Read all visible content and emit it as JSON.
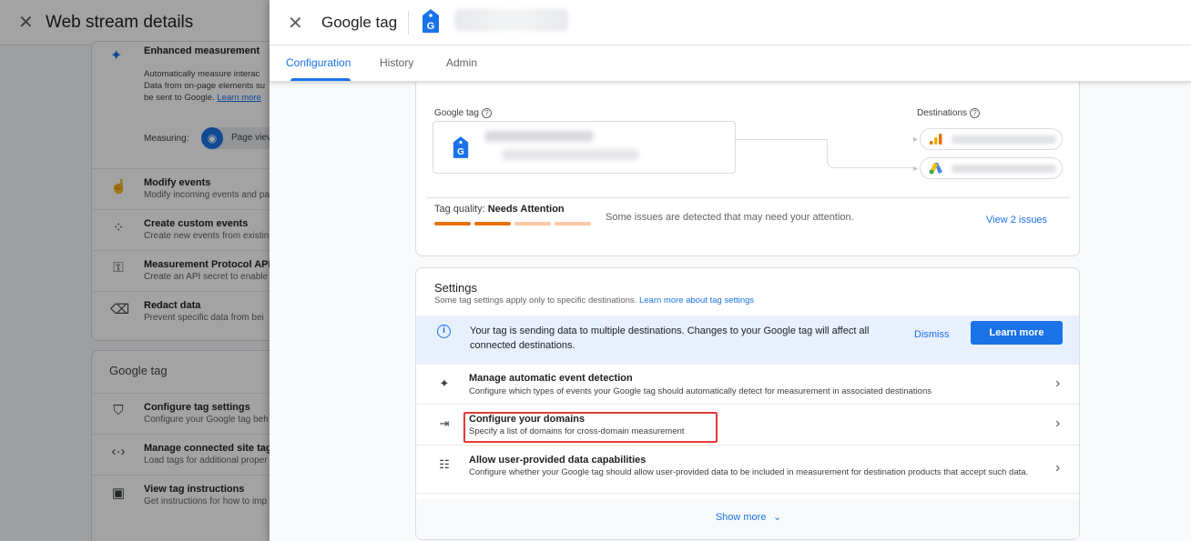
{
  "background": {
    "title": "Web stream details",
    "enhanced": {
      "title": "Enhanced measurement",
      "desc_line1": "Automatically measure interac",
      "desc_line2": "Data from on-page elements su",
      "desc_line3": "be sent to Google.",
      "learn_more": "Learn more",
      "measuring_label": "Measuring:",
      "pill_label": "Page viev"
    },
    "items": [
      {
        "title": "Modify events",
        "sub": "Modify incoming events and pa"
      },
      {
        "title": "Create custom events",
        "sub": "Create new events from existin"
      },
      {
        "title": "Measurement Protocol API",
        "sub": "Create an API secret to enable"
      },
      {
        "title": "Redact data",
        "sub": "Prevent specific data from bei"
      }
    ],
    "google_tag_heading": "Google tag",
    "tag_items": [
      {
        "title": "Configure tag settings",
        "sub": "Configure your Google tag beh"
      },
      {
        "title": "Manage connected site tag",
        "sub": "Load tags for additional proper"
      },
      {
        "title": "View tag instructions",
        "sub": "Get instructions for how to imp"
      }
    ]
  },
  "drawer": {
    "title": "Google tag",
    "tabs": [
      {
        "label": "Configuration",
        "active": true
      },
      {
        "label": "History",
        "active": false
      },
      {
        "label": "Admin",
        "active": false
      }
    ],
    "overview": {
      "google_tag_label": "Google tag",
      "destinations_label": "Destinations",
      "tag_quality_label": "Tag quality:",
      "tag_quality_value": "Needs Attention",
      "quality_message": "Some issues are detected that may need your attention.",
      "view_issues": "View 2 issues"
    },
    "settings": {
      "title": "Settings",
      "subtitle": "Some tag settings apply only to specific destinations.",
      "subtitle_link": "Learn more about tag settings",
      "banner_message": "Your tag is sending data to multiple destinations. Changes to your Google tag will affect all connected destinations.",
      "dismiss": "Dismiss",
      "learn_more": "Learn more",
      "rows": [
        {
          "title": "Manage automatic event detection",
          "sub": "Configure which types of events your Google tag should automatically detect for measurement in associated destinations"
        },
        {
          "title": "Configure your domains",
          "sub": "Specify a list of domains for cross-domain measurement"
        },
        {
          "title": "Allow user-provided data capabilities",
          "sub": "Configure whether your Google tag should allow user-provided data to be included in measurement for destination products that accept such data."
        }
      ],
      "show_more": "Show more"
    }
  },
  "colors": {
    "accent": "#1a73e8",
    "quality_dark": "#e8710a",
    "quality_light": "#fbc8a6",
    "highlight": "#e53935"
  },
  "icons": {
    "close": "close-icon",
    "info": "info-icon",
    "chevron": "chevron-right-icon",
    "sparkle": "sparkle-icon",
    "merge": "merge-arrows-icon",
    "data": "user-data-icon",
    "analytics": "analytics-icon",
    "ads": "google-ads-icon"
  }
}
